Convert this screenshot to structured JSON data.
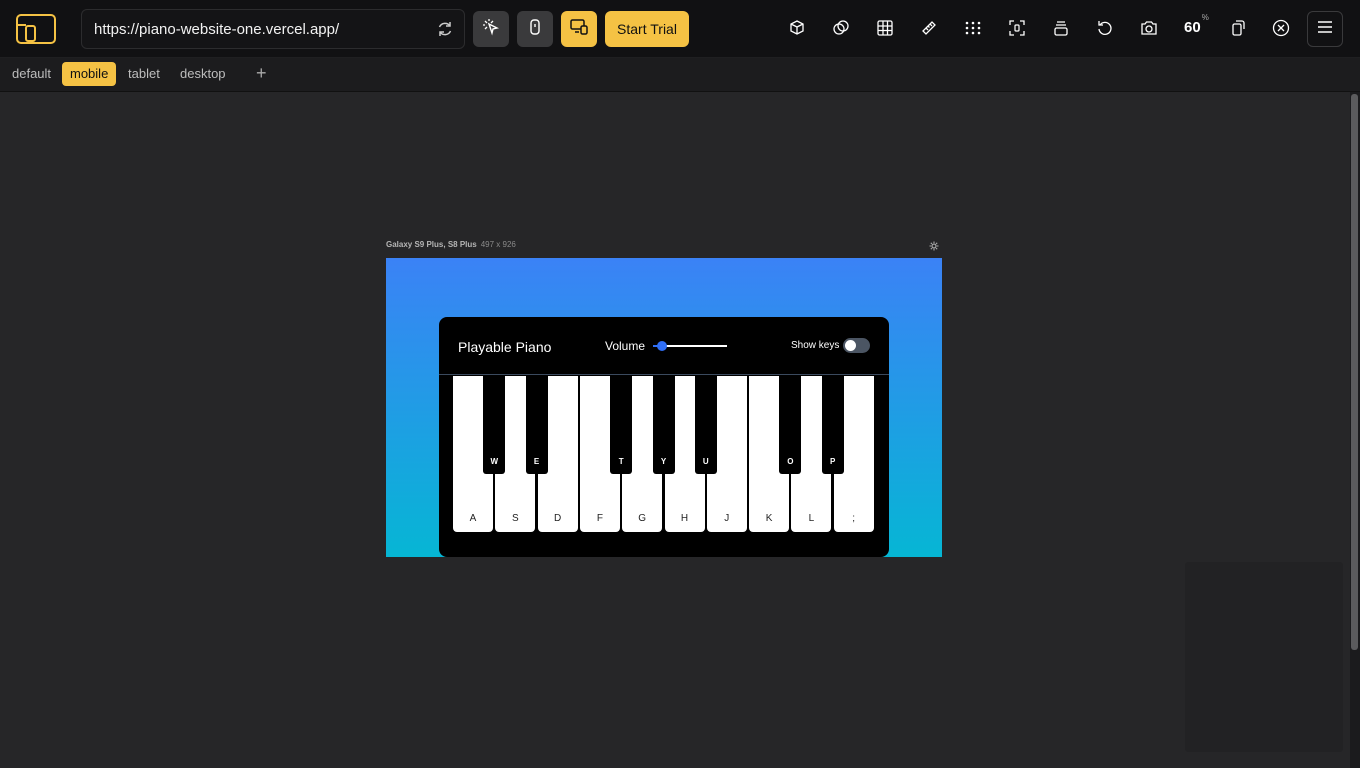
{
  "toolbar": {
    "url": "https://piano-website-one.vercel.app/",
    "start_trial_label": "Start Trial",
    "zoom_value": "60",
    "zoom_unit": "%",
    "icons": [
      "inspect-icon",
      "phone-icon",
      "responsive-icon",
      "cube-icon",
      "overlap-icon",
      "grid-icon",
      "ruler-icon",
      "dots-grid-icon",
      "screenshot-frame-icon",
      "layers-icon",
      "rotate-icon",
      "camera-icon",
      "device-rotate-icon",
      "close-icon",
      "hamburger-icon"
    ],
    "accent_color": "#f5c244"
  },
  "presets": {
    "tabs": [
      "default",
      "mobile",
      "tablet",
      "desktop"
    ],
    "active": "mobile",
    "add_label": "+"
  },
  "device": {
    "name": "Galaxy S9 Plus, S8 Plus",
    "size": "497 x 926"
  },
  "piano": {
    "title": "Playable Piano",
    "volume_label": "Volume",
    "volume_level": 0.12,
    "show_keys_label": "Show keys",
    "show_keys_on": false,
    "white_keys": [
      "A",
      "S",
      "D",
      "F",
      "G",
      "H",
      "J",
      "K",
      "L",
      ";"
    ],
    "black_keys": [
      "W",
      "E",
      "T",
      "Y",
      "U",
      "O",
      "P"
    ],
    "gradient_colors": [
      "#3b82f6",
      "#06b6d4"
    ]
  }
}
